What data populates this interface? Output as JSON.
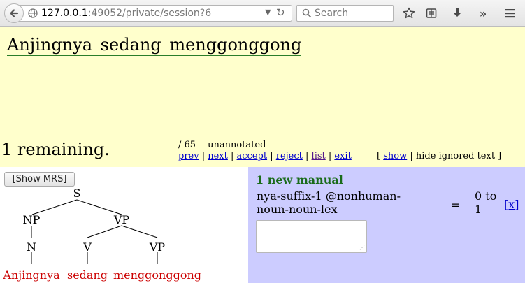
{
  "browser": {
    "url_host": "127.0.0.1",
    "url_rest": ":49052/private/session?6",
    "search_placeholder": "Search"
  },
  "sentence": "Anjingnya sedang menggonggong",
  "status": {
    "remaining": "1 remaining.",
    "count_text": "/ 65 -- unannotated"
  },
  "nav": {
    "prev": "prev",
    "next": "next",
    "accept": "accept",
    "reject": "reject",
    "list": "list",
    "exit": "exit",
    "sep": " | "
  },
  "ignored": {
    "open": "[ ",
    "show": "show",
    "rest": " | hide ignored text ]"
  },
  "tree": {
    "show_mrs_label": "[Show MRS]",
    "nodes": {
      "root": "S",
      "np": "NP",
      "vp": "VP",
      "n": "N",
      "v": "V",
      "vp2": "VP"
    },
    "leaves": [
      "Anjingnya",
      "sedang",
      "menggonggong"
    ]
  },
  "manual": {
    "title": "1 new manual",
    "rule_name": "nya-suffix-1 @nonhuman-noun-noun-lex",
    "equals": "=",
    "range": "0 to 1",
    "remove": "[x]",
    "note_value": ""
  }
}
